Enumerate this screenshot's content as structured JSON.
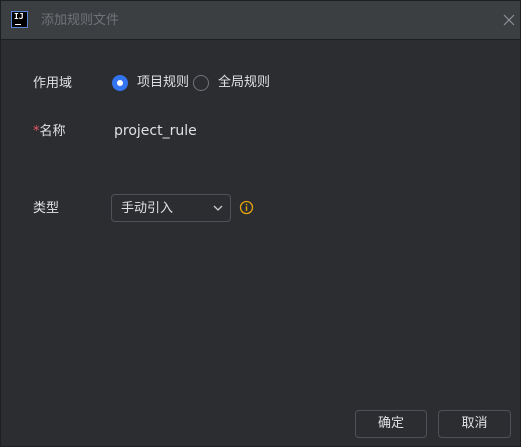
{
  "window": {
    "title": "添加规则文件",
    "app_icon_text": "IJ"
  },
  "form": {
    "scope_label": "作用域",
    "scope_options": [
      {
        "label": "项目规则",
        "selected": true
      },
      {
        "label": "全局规则",
        "selected": false
      }
    ],
    "name_required_mark": "*",
    "name_label": "名称",
    "name_value": "project_rule",
    "type_label": "类型",
    "type_value": "手动引入"
  },
  "footer": {
    "ok_label": "确定",
    "cancel_label": "取消"
  },
  "colors": {
    "background": "#2b2d30",
    "titlebar": "#3c3f41",
    "accent": "#3574f0",
    "required": "#e55765",
    "info": "#e6a30e",
    "text": "#dfe1e5",
    "muted_text": "#6f737a"
  },
  "icons": {
    "app": "intellij-idea-icon",
    "close": "close-icon",
    "dropdown": "chevron-down-icon",
    "info": "info-icon"
  }
}
